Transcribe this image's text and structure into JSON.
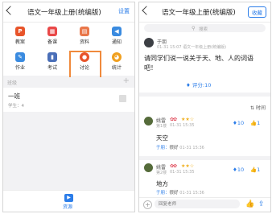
{
  "left": {
    "title": "语文一年级上册(统编版)",
    "settings": "设置",
    "grid": [
      {
        "label": "教案",
        "glyph": "P",
        "color": "#e8542a",
        "icon": "lesson-plan-icon"
      },
      {
        "label": "备课",
        "glyph": "▦",
        "color": "#e94848",
        "icon": "prepare-icon"
      },
      {
        "label": "资料",
        "glyph": "▤",
        "color": "#e9774a",
        "icon": "materials-icon"
      },
      {
        "label": "通知",
        "glyph": "◀",
        "color": "#3a8be0",
        "icon": "notice-icon"
      },
      {
        "label": "作业",
        "glyph": "✎",
        "color": "#3a8be0",
        "icon": "homework-icon"
      },
      {
        "label": "考试",
        "glyph": "▮",
        "color": "#4a6fb8",
        "icon": "exam-icon"
      },
      {
        "label": "讨论",
        "glyph": "●",
        "color": "#e8542a",
        "icon": "discussion-icon"
      },
      {
        "label": "统计",
        "glyph": "◕",
        "color": "#f0a020",
        "icon": "statistics-icon"
      }
    ],
    "section_label": "班级",
    "class_card": {
      "name": "一班",
      "sub": "学生：4"
    },
    "bottom_nav": "资源"
  },
  "right": {
    "title": "语文一年级上册(统编版)",
    "favorite": "收藏",
    "search_placeholder": "搜索",
    "teacher": {
      "name": "于朋",
      "time": "01-31 15:07 语文一年级上册(统编版)"
    },
    "question": "请同学们说一说关于天、地、人的词语吧！",
    "reward": "评分:10",
    "sort_label": "时间",
    "replies": [
      {
        "name": "姚雷",
        "floor": "第1楼",
        "time": "01-31 15:35",
        "answer": "天空",
        "score": "10",
        "likes": "1",
        "commenter": "于朋：",
        "comment": "很好",
        "comment_time": "01-31 15:36"
      },
      {
        "name": "姚雷",
        "floor": "第2楼",
        "time": "01-31 15:35",
        "answer": "地方",
        "score": "10",
        "likes": "1",
        "commenter": "于朋：",
        "comment": "很好",
        "comment_time": "01-31 15:36"
      }
    ],
    "input_placeholder": "回复老师"
  }
}
